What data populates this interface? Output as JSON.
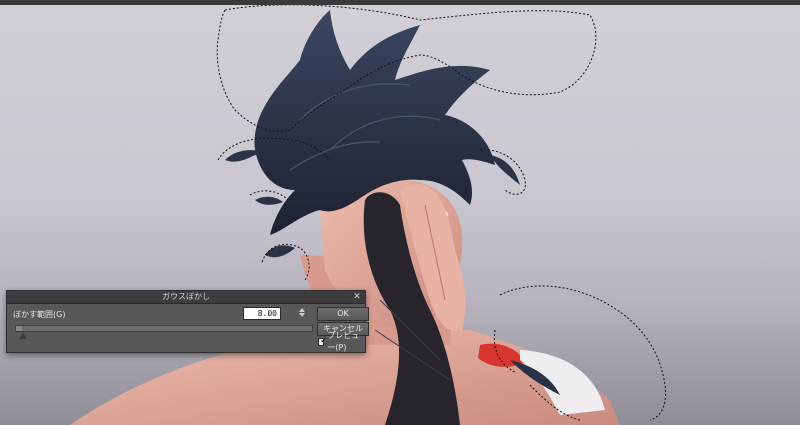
{
  "dialog": {
    "title": "ガウスぼかし",
    "close_glyph": "✕",
    "field_label": "ぼかす範囲(G)",
    "value": "8.00",
    "slider_fraction": 0.02,
    "ok_label": "OK",
    "cancel_label": "キャンセル",
    "preview_label": "プレビュー(P)",
    "preview_checked": true,
    "check_glyph": "✓"
  },
  "canvas": {
    "artwork": "illustration-figure-with-selection"
  },
  "colors": {
    "canvas_bg": "#ccc9d0",
    "hair": "#2a3245",
    "skin": "#e2a99c",
    "glove": "#27252b",
    "accent_red": "#d6362f",
    "dialog_bg": "#585858"
  }
}
